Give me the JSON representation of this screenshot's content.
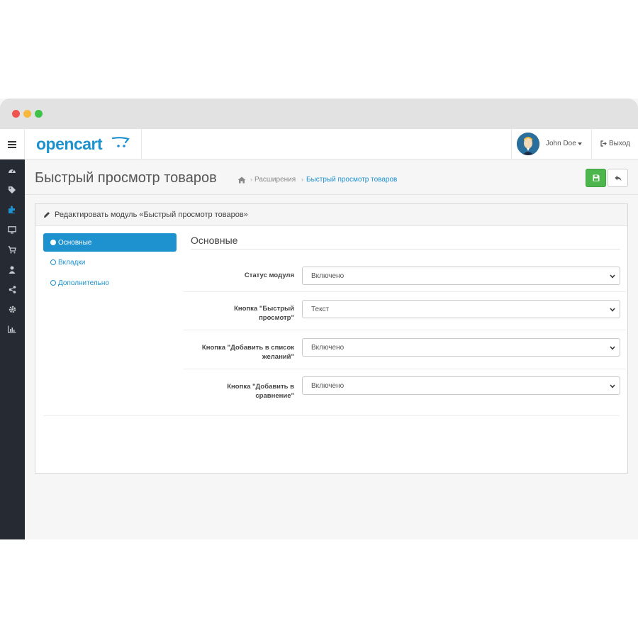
{
  "header": {
    "logo_text": "opencart",
    "user_name": "John Doe",
    "logout_label": "Выход"
  },
  "sidebar": {
    "icons": [
      "dashboard-icon",
      "tag-icon",
      "puzzle-icon",
      "desktop-icon",
      "cart-icon",
      "user-icon",
      "share-icon",
      "gear-icon",
      "bar-chart-icon"
    ]
  },
  "page": {
    "title": "Быстрый просмотр товаров",
    "breadcrumb": {
      "item1": "Расширения",
      "item2": "Быстрый просмотр товаров"
    }
  },
  "panel": {
    "title": "Редактировать модуль «Быстрый просмотр товаров»",
    "tabs": [
      {
        "label": "Основные",
        "active": true
      },
      {
        "label": "Вкладки",
        "active": false
      },
      {
        "label": "Дополнительно",
        "active": false
      }
    ],
    "section_title": "Основные",
    "fields": [
      {
        "label_line1": "Статус модуля",
        "label_line2": "",
        "value": "Включено"
      },
      {
        "label_line1": "Кнопка \"Быстрый",
        "label_line2": "просмотр\"",
        "value": "Текст"
      },
      {
        "label_line1": "Кнопка \"Добавить в список",
        "label_line2": "желаний\"",
        "value": "Включено"
      },
      {
        "label_line1": "Кнопка \"Добавить в",
        "label_line2": "сравнение\"",
        "value": "Включено"
      }
    ]
  },
  "colors": {
    "primary": "#1e91cf",
    "success": "#4cb64c",
    "sidebar": "#262b33"
  }
}
